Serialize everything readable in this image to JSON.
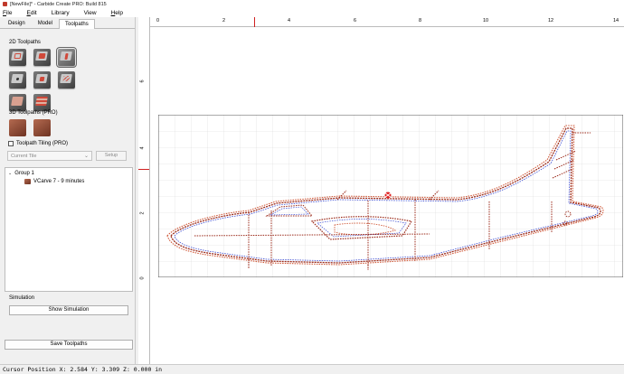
{
  "window": {
    "title": "[NewFile]* - Carbide Create PRO: Build 815"
  },
  "menu": [
    {
      "key": "F",
      "rest": "ile"
    },
    {
      "key": "E",
      "rest": "dit"
    },
    {
      "key": "",
      "rest": "Library"
    },
    {
      "key": "",
      "rest": "View"
    },
    {
      "key": "H",
      "rest": "elp"
    }
  ],
  "tabs": [
    {
      "label": "Design",
      "active": false
    },
    {
      "label": "Model",
      "active": false
    },
    {
      "label": "Toolpaths",
      "active": true
    }
  ],
  "toolpaths_2d": {
    "title": "2D Toolpaths",
    "tools": [
      "contour-tool",
      "pocket-tool",
      "vcarve-tool",
      "drill-tool",
      "advanced-vcarve-tool",
      "texture-tool",
      "flat-rough-tool",
      "chamfer-tool"
    ],
    "selected_index": 2
  },
  "toolpaths_3d": {
    "title": "3D Toolpaths (PRO)",
    "tools": [
      "3d-rough-tool",
      "3d-finish-tool"
    ]
  },
  "tiling": {
    "label": "Toolpath Tiling (PRO)",
    "checked": false
  },
  "tile_select": {
    "value": "Current Tile",
    "setup_label": "Setup"
  },
  "tree": {
    "group_label": "Group 1",
    "item_label": "VCarve 7 - 9 minutes"
  },
  "simulation": {
    "title": "Simulation",
    "show_label": "Show Simulation",
    "save_label": "Save Toolpaths"
  },
  "rulers": {
    "x_labels": [
      "0",
      "2",
      "4",
      "6",
      "8",
      "10",
      "12",
      "14"
    ],
    "y_labels": [
      "6",
      "4",
      "2",
      "0"
    ],
    "cursor_marker_color": "#d02020"
  },
  "status": {
    "text": "Cursor Position X: 2.584 Y: 3.309 Z: 0.000 in"
  },
  "colors": {
    "toolpath_outer": "#d05a3a",
    "toolpath_inner": "#3a4ad0",
    "toolpath_centerline": "#9b2a1a"
  }
}
